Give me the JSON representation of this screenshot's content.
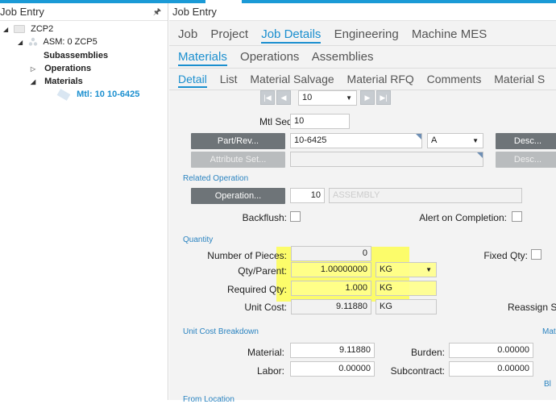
{
  "left_panel": {
    "title": "Job Entry",
    "pin": "🖈",
    "tree": {
      "job": "ZCP2",
      "assembly": "ASM: 0 ZCP5",
      "subassemblies": "Subassemblies",
      "operations": "Operations",
      "materials": "Materials",
      "material_item": "Mtl: 10 10-6425"
    }
  },
  "right_panel": {
    "title": "Job Entry",
    "tabs_main": [
      "Job",
      "Project",
      "Job Details",
      "Engineering",
      "Machine MES"
    ],
    "tabs_sub": [
      "Materials",
      "Operations",
      "Assemblies"
    ],
    "tabs_detail": [
      "Detail",
      "List",
      "Material Salvage",
      "Material RFQ",
      "Comments",
      "Material S"
    ],
    "nav_value": "10",
    "mtl_seq_label": "Mtl Seq:",
    "mtl_seq_value": "10",
    "part_rev_button": "Part/Rev...",
    "part_value": "10-6425",
    "rev_value": "A",
    "desc_button": "Desc...",
    "attribute_set_button": "Attribute Set...",
    "related_operation_section": "Related Operation",
    "operation_button": "Operation...",
    "operation_value": "10",
    "operation_desc": "ASSEMBLY",
    "backflush_label": "Backflush:",
    "alert_label": "Alert on Completion:",
    "quantity_section": "Quantity",
    "number_of_pieces_label": "Number of Pieces:",
    "number_of_pieces_value": "0",
    "fixed_qty_label": "Fixed Qty:",
    "qty_parent_label": "Qty/Parent:",
    "qty_parent_value": "1.00000000",
    "qty_parent_uom": "KG",
    "required_qty_label": "Required Qty:",
    "required_qty_value": "1.000",
    "required_qty_uom": "KG",
    "unit_cost_label": "Unit Cost:",
    "unit_cost_value": "9.11880",
    "unit_cost_uom": "KG",
    "reassign_label": "Reassign S",
    "unit_cost_breakdown_section": "Unit Cost Breakdown",
    "mat_section_cut": "Mat",
    "material_label": "Material:",
    "material_value": "9.11880",
    "burden_label": "Burden:",
    "burden_value": "0.00000",
    "labor_label": "Labor:",
    "labor_value": "0.00000",
    "subcontract_label": "Subcontract:",
    "subcontract_value": "0.00000",
    "from_location_section": "From Location",
    "bl_cut": "Bl"
  }
}
